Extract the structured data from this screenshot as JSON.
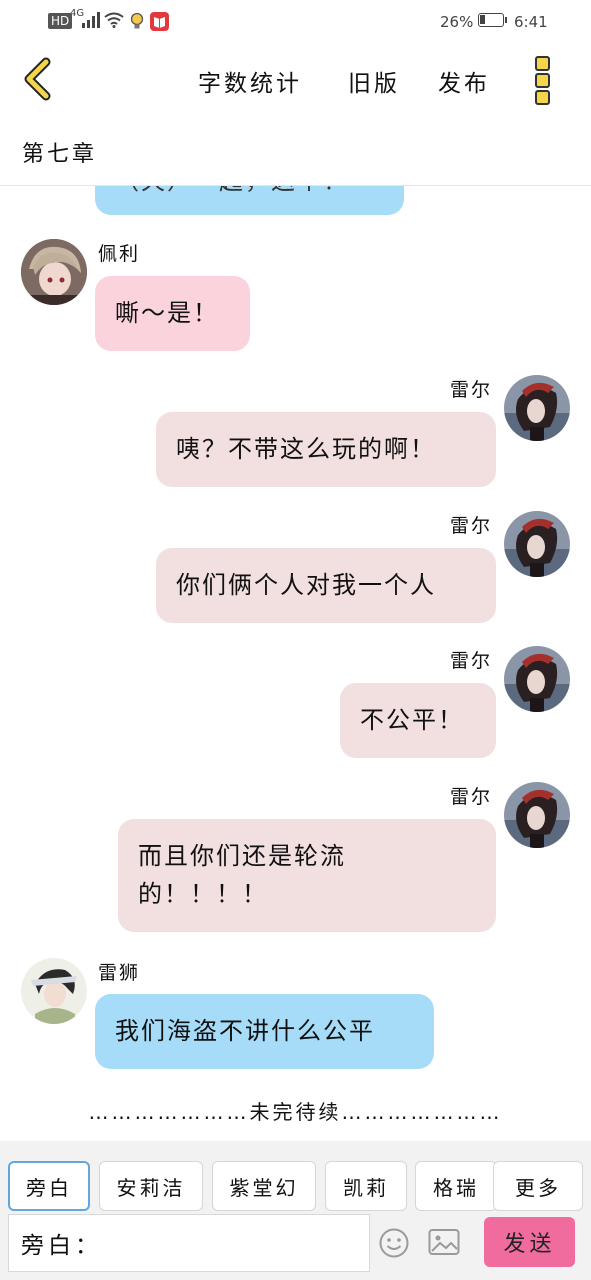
{
  "status_bar": {
    "network": "HD",
    "signal_type": "4G",
    "battery_percent": "26%",
    "battery_level": 0.26,
    "time": "6:41"
  },
  "header": {
    "word_count_label": "字数统计",
    "old_version_label": "旧版",
    "publish_label": "发布"
  },
  "chapter": {
    "title": "第七章"
  },
  "messages": [
    {
      "speaker": "",
      "text": "（天）一起，这个！",
      "side": "left",
      "bubble": "blue"
    },
    {
      "speaker": "佩利",
      "text": "嘶～是！",
      "side": "left",
      "bubble": "pink"
    },
    {
      "speaker": "雷尔",
      "text": "咦？不带这么玩的啊！",
      "side": "right",
      "bubble": "rose"
    },
    {
      "speaker": "雷尔",
      "text": "你们俩个人对我一个人",
      "side": "right",
      "bubble": "rose"
    },
    {
      "speaker": "雷尔",
      "text": "不公平！",
      "side": "right",
      "bubble": "rose"
    },
    {
      "speaker": "雷尔",
      "text_line1": "而且你们还是轮流",
      "text_line2": "的！！！！",
      "side": "right",
      "bubble": "rose"
    },
    {
      "speaker": "雷狮",
      "text": "我们海盗不讲什么公平",
      "side": "left",
      "bubble": "blue"
    }
  ],
  "to_be_continued": "…………………未完待续…………………",
  "toolbar": {
    "roles": [
      "旁白",
      "安莉洁",
      "紫堂幻",
      "凯莉",
      "格瑞",
      "更多"
    ],
    "active_role": "旁白",
    "input_value": "旁白：",
    "send_label": "发送"
  },
  "colors": {
    "accent_yellow": "#f3d64a",
    "blue_bubble": "#a6dcf8",
    "pink_bubble": "#fbd3dc",
    "rose_bubble": "#f2dfe0",
    "send_button": "#f06c9e",
    "active_role_border": "#62a6e0"
  }
}
